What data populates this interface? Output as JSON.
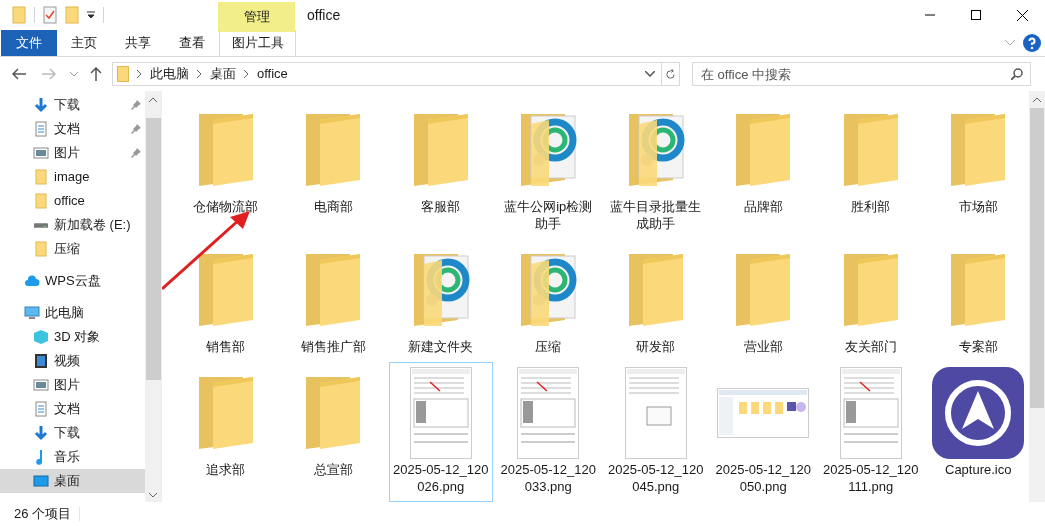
{
  "window": {
    "title": "office",
    "context_tab_group": "管理"
  },
  "ribbon_tabs": [
    {
      "label": "文件",
      "kind": "file",
      "selected": false
    },
    {
      "label": "主页",
      "kind": "tab",
      "selected": false
    },
    {
      "label": "共享",
      "kind": "tab",
      "selected": false
    },
    {
      "label": "查看",
      "kind": "tab",
      "selected": false
    },
    {
      "label": "图片工具",
      "kind": "context",
      "selected": false
    }
  ],
  "breadcrumb": [
    "此电脑",
    "桌面",
    "office"
  ],
  "search": {
    "placeholder": "在 office 中搜索"
  },
  "sidebar": {
    "quick_access": [
      {
        "label": "下载",
        "kind": "download",
        "pinned": true,
        "selected": false
      },
      {
        "label": "文档",
        "kind": "doc",
        "pinned": true,
        "selected": false
      },
      {
        "label": "图片",
        "kind": "picture",
        "pinned": true,
        "selected": false
      },
      {
        "label": "image",
        "kind": "folder",
        "pinned": false,
        "selected": false
      },
      {
        "label": "office",
        "kind": "folder",
        "pinned": false,
        "selected": false
      },
      {
        "label": "新加载卷 (E:)",
        "kind": "drive",
        "pinned": false,
        "selected": false
      },
      {
        "label": "压缩",
        "kind": "folder",
        "pinned": false,
        "selected": false
      }
    ],
    "roots": [
      {
        "label": "WPS云盘",
        "kind": "cloud",
        "selected": false
      },
      {
        "label": "此电脑",
        "kind": "pc",
        "selected": false,
        "children": [
          {
            "label": "3D 对象",
            "kind": "cube",
            "selected": false
          },
          {
            "label": "视频",
            "kind": "video",
            "selected": false
          },
          {
            "label": "图片",
            "kind": "picture",
            "selected": false
          },
          {
            "label": "文档",
            "kind": "doc",
            "selected": false
          },
          {
            "label": "下载",
            "kind": "download",
            "selected": false
          },
          {
            "label": "音乐",
            "kind": "music",
            "selected": false
          },
          {
            "label": "桌面",
            "kind": "desktop",
            "selected": true
          }
        ]
      }
    ]
  },
  "files": [
    {
      "name": "仓储物流部",
      "kind": "folder",
      "selected": false
    },
    {
      "name": "电商部",
      "kind": "folder",
      "selected": false
    },
    {
      "name": "客服部",
      "kind": "folder",
      "selected": false
    },
    {
      "name": "蓝牛公网ip检测助手",
      "kind": "app-folder",
      "selected": false
    },
    {
      "name": "蓝牛目录批量生成助手",
      "kind": "app-folder",
      "selected": false
    },
    {
      "name": "品牌部",
      "kind": "folder",
      "selected": false
    },
    {
      "name": "胜利部",
      "kind": "folder",
      "selected": false
    },
    {
      "name": "市场部",
      "kind": "folder",
      "selected": false
    },
    {
      "name": "销售部",
      "kind": "folder",
      "selected": false
    },
    {
      "name": "销售推广部",
      "kind": "folder",
      "selected": false
    },
    {
      "name": "新建文件夹",
      "kind": "app-folder",
      "selected": false
    },
    {
      "name": "压缩",
      "kind": "app-folder",
      "selected": false
    },
    {
      "name": "研发部",
      "kind": "folder",
      "selected": false
    },
    {
      "name": "营业部",
      "kind": "folder",
      "selected": false
    },
    {
      "name": "友关部门",
      "kind": "folder",
      "selected": false
    },
    {
      "name": "专案部",
      "kind": "folder",
      "selected": false
    },
    {
      "name": "追求部",
      "kind": "folder",
      "selected": false
    },
    {
      "name": "总宣部",
      "kind": "folder",
      "selected": false
    },
    {
      "name": "2025-05-12_120026.png",
      "kind": "screenshot",
      "selected": true
    },
    {
      "name": "2025-05-12_120033.png",
      "kind": "screenshot",
      "selected": false
    },
    {
      "name": "2025-05-12_120045.png",
      "kind": "dialog-shot",
      "selected": false
    },
    {
      "name": "2025-05-12_120050.png",
      "kind": "wide-shot",
      "selected": false
    },
    {
      "name": "2025-05-12_120111.png",
      "kind": "screenshot",
      "selected": false
    },
    {
      "name": "Capture.ico",
      "kind": "ico",
      "selected": false
    }
  ],
  "status_bar": {
    "count": "26 个项目"
  }
}
